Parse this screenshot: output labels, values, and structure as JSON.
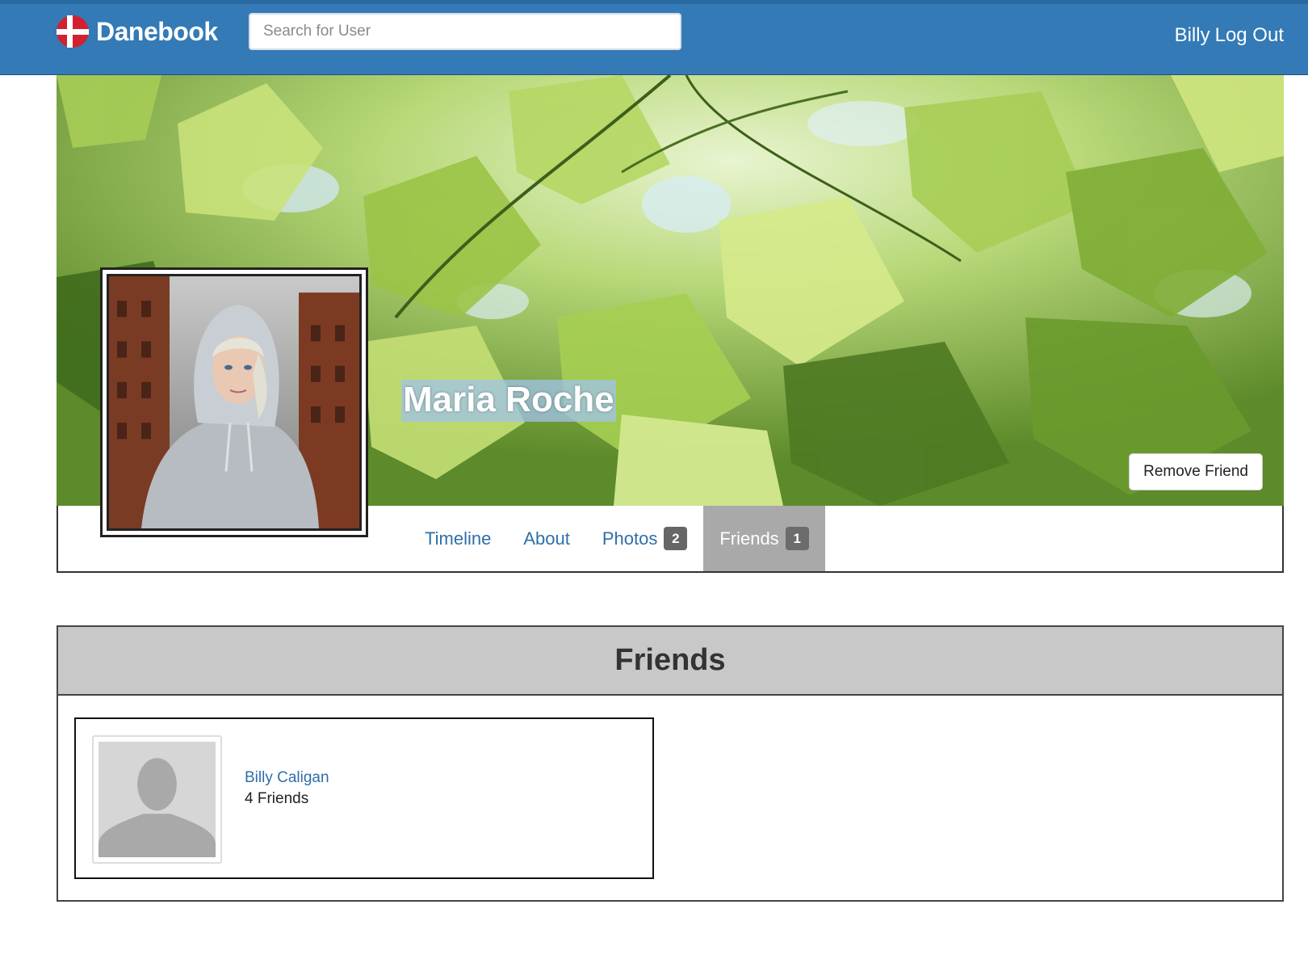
{
  "app": {
    "brand": "Danebook",
    "brand_colors": {
      "navbar": "#337ab7",
      "flag_red": "#d32030"
    }
  },
  "navbar": {
    "search_placeholder": "Search for User",
    "user_name": "Billy",
    "logout_label": "Log Out"
  },
  "profile": {
    "name": "Maria Roche",
    "remove_friend_label": "Remove Friend",
    "tabs": [
      {
        "label": "Timeline"
      },
      {
        "label": "About"
      },
      {
        "label": "Photos",
        "badge": "2"
      },
      {
        "label": "Friends",
        "badge": "1",
        "active": true
      }
    ]
  },
  "friends_section": {
    "title": "Friends",
    "friends": [
      {
        "name": "Billy Caligan",
        "friend_count": "4 Friends"
      }
    ]
  }
}
